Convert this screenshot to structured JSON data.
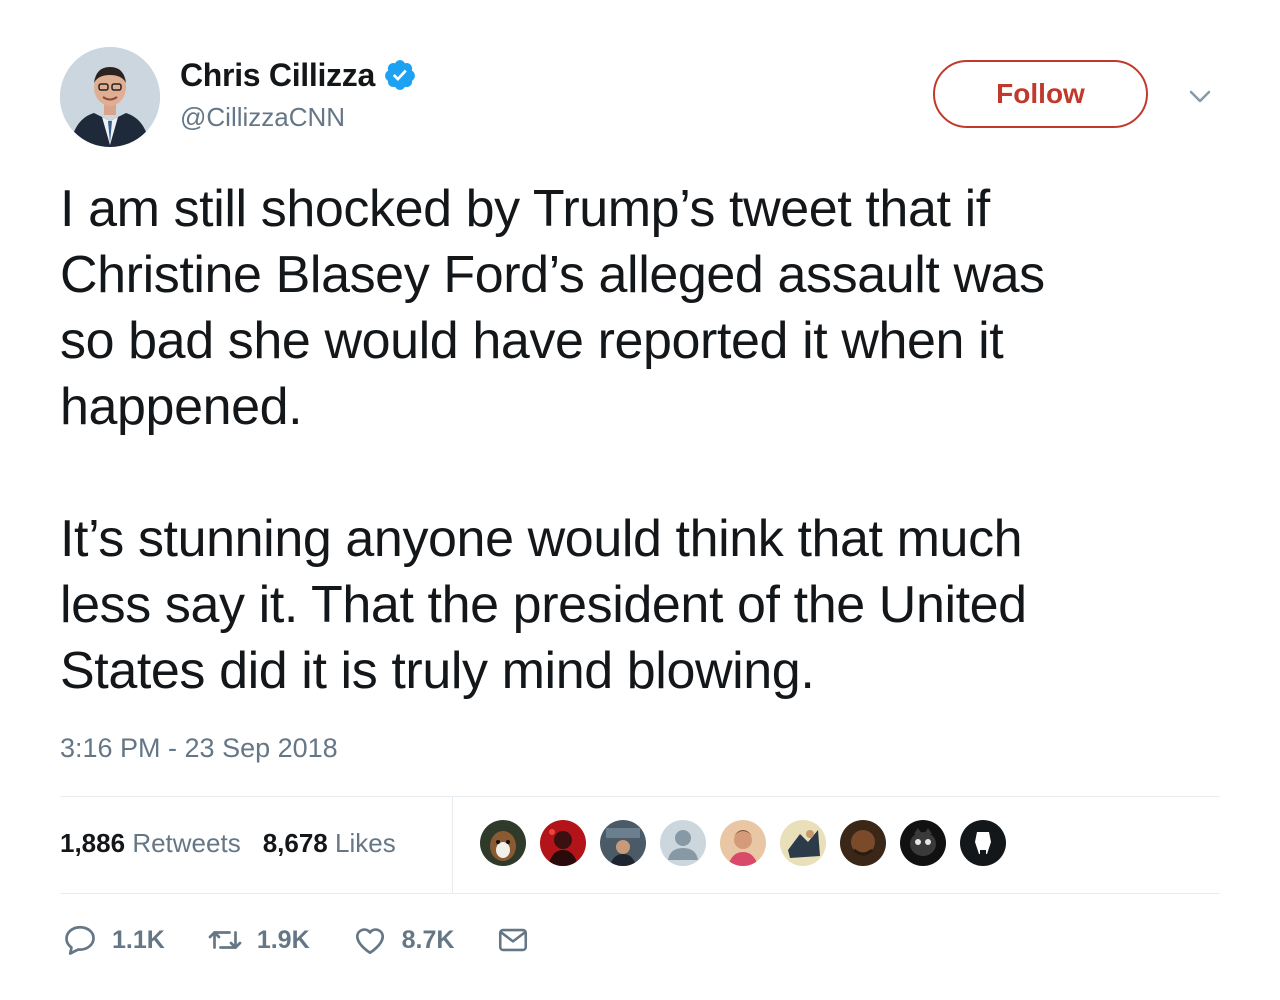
{
  "author": {
    "display_name": "Chris Cillizza",
    "handle": "@CillizzaCNN",
    "verified_icon": "verified-badge-icon"
  },
  "follow_button": {
    "label": "Follow",
    "color": "#c0392b"
  },
  "tweet": {
    "paragraph_1": "I am still shocked by Trump’s tweet that if\nChristine Blasey Ford’s alleged assault was\nso bad she would have reported it when it\nhappened.",
    "paragraph_2": "It’s stunning anyone would think that much\nless say it. That the president of the United\nStates did it is truly mind blowing.",
    "timestamp": "3:16 PM - 23 Sep 2018"
  },
  "stats": {
    "retweets_count": "1,886",
    "retweets_label": "Retweets",
    "likes_count": "8,678",
    "likes_label": "Likes"
  },
  "likers": [
    "liker-avatar-1",
    "liker-avatar-2",
    "liker-avatar-3",
    "liker-avatar-4",
    "liker-avatar-5",
    "liker-avatar-6",
    "liker-avatar-7",
    "liker-avatar-8",
    "liker-avatar-9"
  ],
  "actions": {
    "reply_count": "1.1K",
    "retweet_count": "1.9K",
    "like_count": "8.7K"
  },
  "colors": {
    "text": "#14171a",
    "secondary": "#657786",
    "verified": "#1da1f2",
    "divider": "#e6ecf0"
  }
}
